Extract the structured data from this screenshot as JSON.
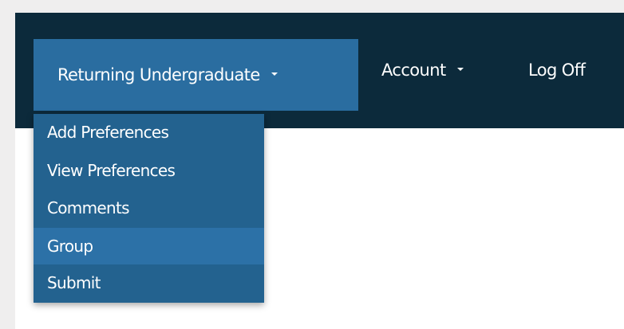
{
  "navbar": {
    "items": [
      {
        "label": "Returning Undergraduate"
      },
      {
        "label": "Account"
      },
      {
        "label": "Log Off"
      }
    ]
  },
  "dropdown": {
    "items": [
      {
        "label": "Add Preferences"
      },
      {
        "label": "View Preferences"
      },
      {
        "label": "Comments"
      },
      {
        "label": "Group"
      },
      {
        "label": "Submit"
      }
    ]
  },
  "colors": {
    "navbar_bg": "#0c2a3b",
    "active_item_bg": "#2a6da0",
    "dropdown_bg": "#23628f",
    "dropdown_hover_bg": "#2c71a7",
    "page_bg": "#ffffff",
    "outer_bg": "#efeeee"
  }
}
